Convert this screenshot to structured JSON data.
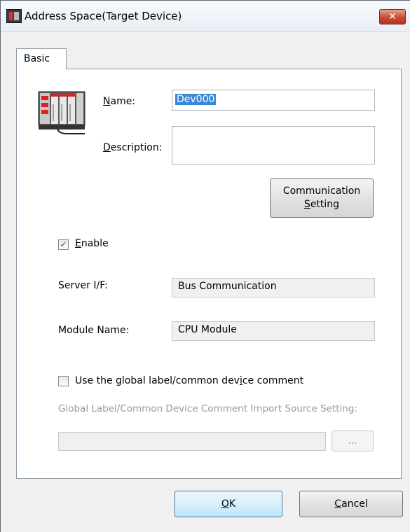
{
  "window": {
    "title": "Address Space(Target Device)",
    "close_glyph": "✕"
  },
  "tabs": [
    {
      "label": "Basic",
      "active": true
    }
  ],
  "form": {
    "name_label_prefix": "",
    "name_label_u": "N",
    "name_label_rest": "ame:",
    "name_value": "Dev000",
    "description_label_u": "D",
    "description_label_rest": "escription:",
    "description_value": "",
    "comm_button_line1": "Communication",
    "comm_button_line2_u": "S",
    "comm_button_line2_rest": "etting",
    "enable_checked": true,
    "enable_label_u": "E",
    "enable_label_rest": "nable",
    "check_glyph": "✓",
    "server_if_label": "Server I/F:",
    "server_if_value": "Bus Communication",
    "module_name_label": "Module Name:",
    "module_name_value": "CPU Module",
    "global_label_checked": false,
    "global_label_text_a": "Use the global label/common dev",
    "global_label_text_u": "i",
    "global_label_text_b": "ce comment",
    "import_source_label": "Global Label/Common Device Comment Import Source Setting:",
    "import_source_value": "",
    "browse_button_label": "..."
  },
  "buttons": {
    "ok_u": "O",
    "ok_rest": "K",
    "cancel_u": "C",
    "cancel_rest": "ancel"
  },
  "icons": {
    "title": "plc-app-icon",
    "device": "plc-device-icon"
  }
}
